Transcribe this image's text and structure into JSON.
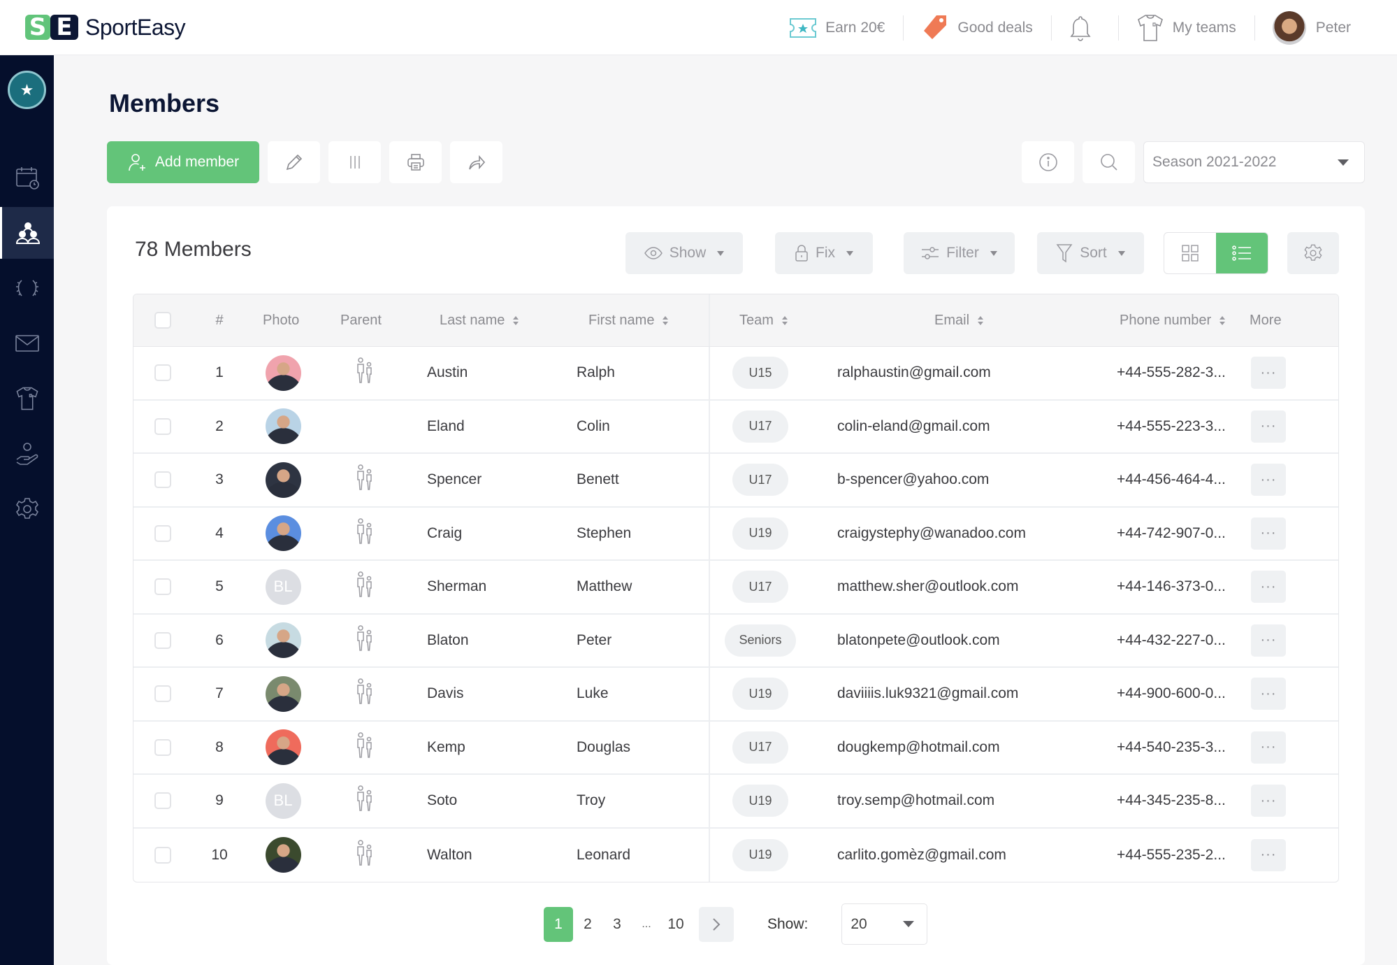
{
  "app": {
    "brand": "SportEasy",
    "logo_letters": [
      "S",
      "E"
    ],
    "brand_colors": {
      "green": "#63c479",
      "navy": "#0c1634",
      "sidebar": "#050f2c"
    }
  },
  "topnav": {
    "earn": {
      "label": "Earn 20€",
      "icon": "ticket-star-icon"
    },
    "deals": {
      "label": "Good deals",
      "icon": "price-tag-icon"
    },
    "notifications": {
      "icon": "bell-icon"
    },
    "teams": {
      "label": "My teams",
      "icon": "jersey-icon"
    },
    "user": {
      "label": "Peter",
      "icon": "user-avatar"
    }
  },
  "sidebar": {
    "club_logo_label": "club-badge",
    "items": [
      {
        "name": "calendar",
        "icon": "calendar-clock-icon",
        "active": false
      },
      {
        "name": "members",
        "icon": "members-icon",
        "active": true
      },
      {
        "name": "trophies",
        "icon": "laurel-icon",
        "active": false
      },
      {
        "name": "messages",
        "icon": "envelope-icon",
        "active": false
      },
      {
        "name": "teams",
        "icon": "jersey-icon",
        "active": false
      },
      {
        "name": "volunteers",
        "icon": "hand-person-icon",
        "active": false
      },
      {
        "name": "settings",
        "icon": "gear-icon",
        "active": false
      }
    ]
  },
  "page": {
    "title": "Members",
    "add_member_label": "Add member",
    "season_selected": "Season 2021-2022"
  },
  "card": {
    "count_title": "78 Members",
    "tools": {
      "show": "Show",
      "fix": "Fix",
      "filter": "Filter",
      "sort": "Sort"
    },
    "view_mode": "list"
  },
  "table": {
    "headers": {
      "num": "#",
      "photo": "Photo",
      "parent": "Parent",
      "last_name": "Last name",
      "first_name": "First name",
      "team": "Team",
      "email": "Email",
      "phone": "Phone number",
      "more": "More"
    },
    "more_label": "···",
    "rows": [
      {
        "num": "1",
        "avatar": "photo",
        "avatar_color": "#f0a3ad",
        "parent": true,
        "last": "Austin",
        "first": "Ralph",
        "team": "U15",
        "email": "ralphaustin@gmail.com",
        "phone": "+44-555-282-3..."
      },
      {
        "num": "2",
        "avatar": "photo",
        "avatar_color": "#b9d3e6",
        "parent": false,
        "last": "Eland",
        "first": "Colin",
        "team": "U17",
        "email": "colin-eland@gmail.com",
        "phone": "+44-555-223-3..."
      },
      {
        "num": "3",
        "avatar": "photo",
        "avatar_color": "#2e3442",
        "parent": true,
        "last": "Spencer",
        "first": "Benett",
        "team": "U17",
        "email": "b-spencer@yahoo.com",
        "phone": "+44-456-464-4..."
      },
      {
        "num": "4",
        "avatar": "photo",
        "avatar_color": "#5b8ee0",
        "parent": true,
        "last": "Craig",
        "first": "Stephen",
        "team": "U19",
        "email": "craigystephy@wanadoo.com",
        "phone": "+44-742-907-0..."
      },
      {
        "num": "5",
        "avatar": "initials",
        "initials": "BL",
        "avatar_color": "#dcdee3",
        "parent": true,
        "last": "Sherman",
        "first": "Matthew",
        "team": "U17",
        "email": "matthew.sher@outlook.com",
        "phone": "+44-146-373-0..."
      },
      {
        "num": "6",
        "avatar": "photo",
        "avatar_color": "#c7dbe2",
        "parent": true,
        "last": "Blaton",
        "first": "Peter",
        "team": "Seniors",
        "email": "blatonpete@outlook.com",
        "phone": "+44-432-227-0..."
      },
      {
        "num": "7",
        "avatar": "photo",
        "avatar_color": "#7a8a6e",
        "parent": true,
        "last": "Davis",
        "first": "Luke",
        "team": "U19",
        "email": "daviiiis.luk9321@gmail.com",
        "phone": "+44-900-600-0..."
      },
      {
        "num": "8",
        "avatar": "photo",
        "avatar_color": "#ef6b5c",
        "parent": true,
        "last": "Kemp",
        "first": "Douglas",
        "team": "U17",
        "email": "dougkemp@hotmail.com",
        "phone": "+44-540-235-3..."
      },
      {
        "num": "9",
        "avatar": "initials",
        "initials": "BL",
        "avatar_color": "#dcdee3",
        "parent": true,
        "last": "Soto",
        "first": "Troy",
        "team": "U19",
        "email": "troy.semp@hotmail.com",
        "phone": "+44-345-235-8..."
      },
      {
        "num": "10",
        "avatar": "photo",
        "avatar_color": "#3b4a2e",
        "parent": true,
        "last": "Walton",
        "first": "Leonard",
        "team": "U19",
        "email": "carlito.gomèz@gmail.com",
        "phone": "+44-555-235-2..."
      }
    ]
  },
  "pagination": {
    "pages": [
      "1",
      "2",
      "3",
      "...",
      "10"
    ],
    "current": "1",
    "show_label": "Show:",
    "page_size": "20"
  }
}
